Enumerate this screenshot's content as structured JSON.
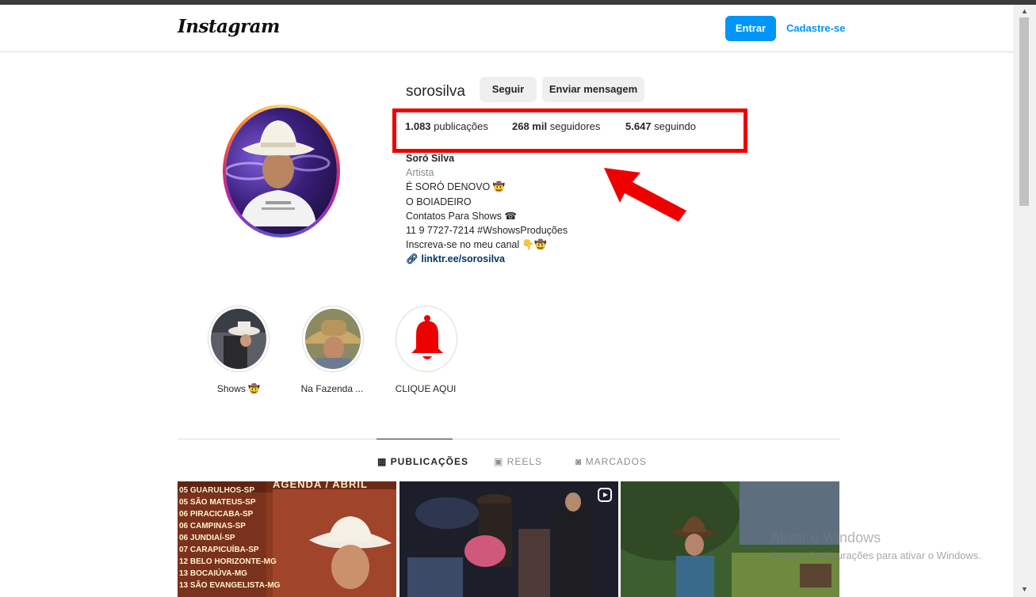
{
  "header": {
    "logo": "Instagram",
    "login_label": "Entrar",
    "signup_label": "Cadastre-se"
  },
  "profile": {
    "username": "sorosilva",
    "follow_label": "Seguir",
    "message_label": "Enviar mensagem",
    "stats": [
      {
        "value": "1.083",
        "label": "publicações"
      },
      {
        "value": "268 mil",
        "label": "seguidores"
      },
      {
        "value": "5.647",
        "label": "seguindo"
      }
    ],
    "bio": {
      "name": "Soró Silva",
      "category": "Artista",
      "lines": [
        "É SORÓ DENOVO 🤠",
        "O BOIADEIRO",
        "Contatos Para Shows ☎",
        "11 9 7727-7214 #WshowsProduções",
        "Inscreva-se no meu canal 👇🤠"
      ],
      "link": "linktr.ee/sorosilva"
    }
  },
  "highlights": [
    {
      "label": "Shows 🤠"
    },
    {
      "label": "Na Fazenda ..."
    },
    {
      "label": "CLIQUE AQUI"
    }
  ],
  "tabs": [
    {
      "label": "PUBLICAÇÕES",
      "icon": "grid-icon"
    },
    {
      "label": "REELS",
      "icon": "reels-icon"
    },
    {
      "label": "MARCADOS",
      "icon": "tagged-icon"
    }
  ],
  "posts": [
    {
      "title": "AGENDA / ABRIL",
      "dates": [
        "05 GUARULHOS-SP",
        "05 SÃO MATEUS-SP",
        "06 PIRACICABA-SP",
        "06 CAMPINAS-SP",
        "06 JUNDIAÍ-SP",
        "07 CARAPICUÍBA-SP",
        "12 BELO HORIZONTE-MG",
        "13 BOCAIÚVA-MG",
        "13 SÃO EVANGELISTA-MG"
      ]
    },
    {
      "title": ""
    },
    {
      "title": ""
    }
  ],
  "watermark": {
    "title": "Ativar o Windows",
    "subtitle": "Acesse Configurações para ativar o Windows."
  }
}
